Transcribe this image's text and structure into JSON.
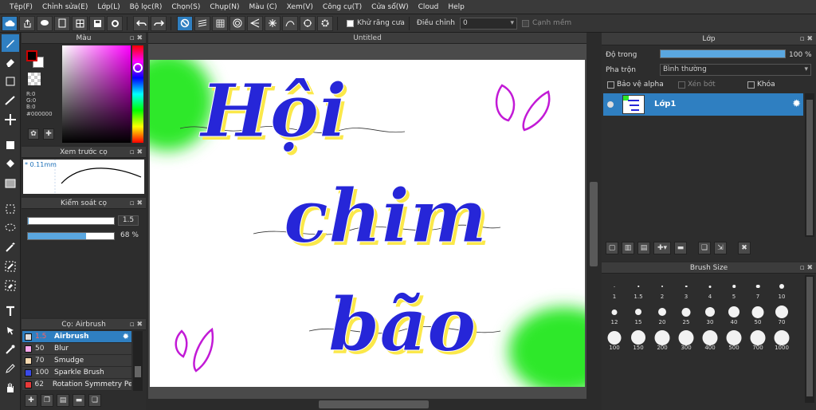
{
  "menu": [
    "Tệp(F)",
    "Chỉnh sửa(E)",
    "Lớp(L)",
    "Bộ lọc(R)",
    "Chọn(S)",
    "Chụp(N)",
    "Màu (C)",
    "Xem(V)",
    "Công cụ(T)",
    "Cửa sổ(W)",
    "Cloud",
    "Help"
  ],
  "toolbar": {
    "antialias_label": "Khử răng cưa",
    "adjust_label": "Điều chỉnh",
    "adjust_value": "0",
    "smooth_label": "Cạnh mềm"
  },
  "color_panel": {
    "title": "Màu",
    "r": "R:0",
    "g": "G:0",
    "b": "B:0",
    "hex": "#000000",
    "fg_color": "#000000",
    "bg_color": "#ffffff"
  },
  "brush_preview": {
    "title": "Xem trước cọ",
    "size": "0.11mm"
  },
  "brush_control": {
    "title": "Kiểm soát cọ",
    "size_value": "1.5",
    "opacity_value": "68 %",
    "opacity_fraction": 0.68
  },
  "brush_list": {
    "title": "Cọ: Airbrush",
    "items": [
      {
        "num": "1.5",
        "name": "Airbrush",
        "color": "#dddddd"
      },
      {
        "num": "50",
        "name": "Blur",
        "color": "#f7a8ec"
      },
      {
        "num": "70",
        "name": "Smudge",
        "color": "#f6d9b0"
      },
      {
        "num": "100",
        "name": "Sparkle Brush",
        "color": "#3a4ae8"
      },
      {
        "num": "62",
        "name": "Rotation Symmetry Pen",
        "color": "#e83a3a"
      }
    ]
  },
  "document": {
    "tab_title": "Untitled"
  },
  "layer_panel": {
    "title": "Lớp",
    "opacity_label": "Độ trong",
    "opacity_value": "100 %",
    "blend_label": "Pha trộn",
    "blend_value": "Bình thường",
    "protect_alpha": "Bảo vệ alpha",
    "clipping": "Xén bớt",
    "lock": "Khóa",
    "layer_name": "Lớp1",
    "colors": {
      "accent": "#2f7fc1"
    }
  },
  "brush_size_panel": {
    "title": "Brush Size",
    "sizes": [
      "1",
      "1.5",
      "2",
      "3",
      "4",
      "5",
      "7",
      "10",
      "12",
      "15",
      "20",
      "25",
      "30",
      "40",
      "50",
      "70",
      "100",
      "150",
      "200",
      "300",
      "400",
      "500",
      "700",
      "1000"
    ]
  },
  "canvas_text": {
    "line1": "Hội",
    "line2": "chim",
    "line3": "bão"
  }
}
